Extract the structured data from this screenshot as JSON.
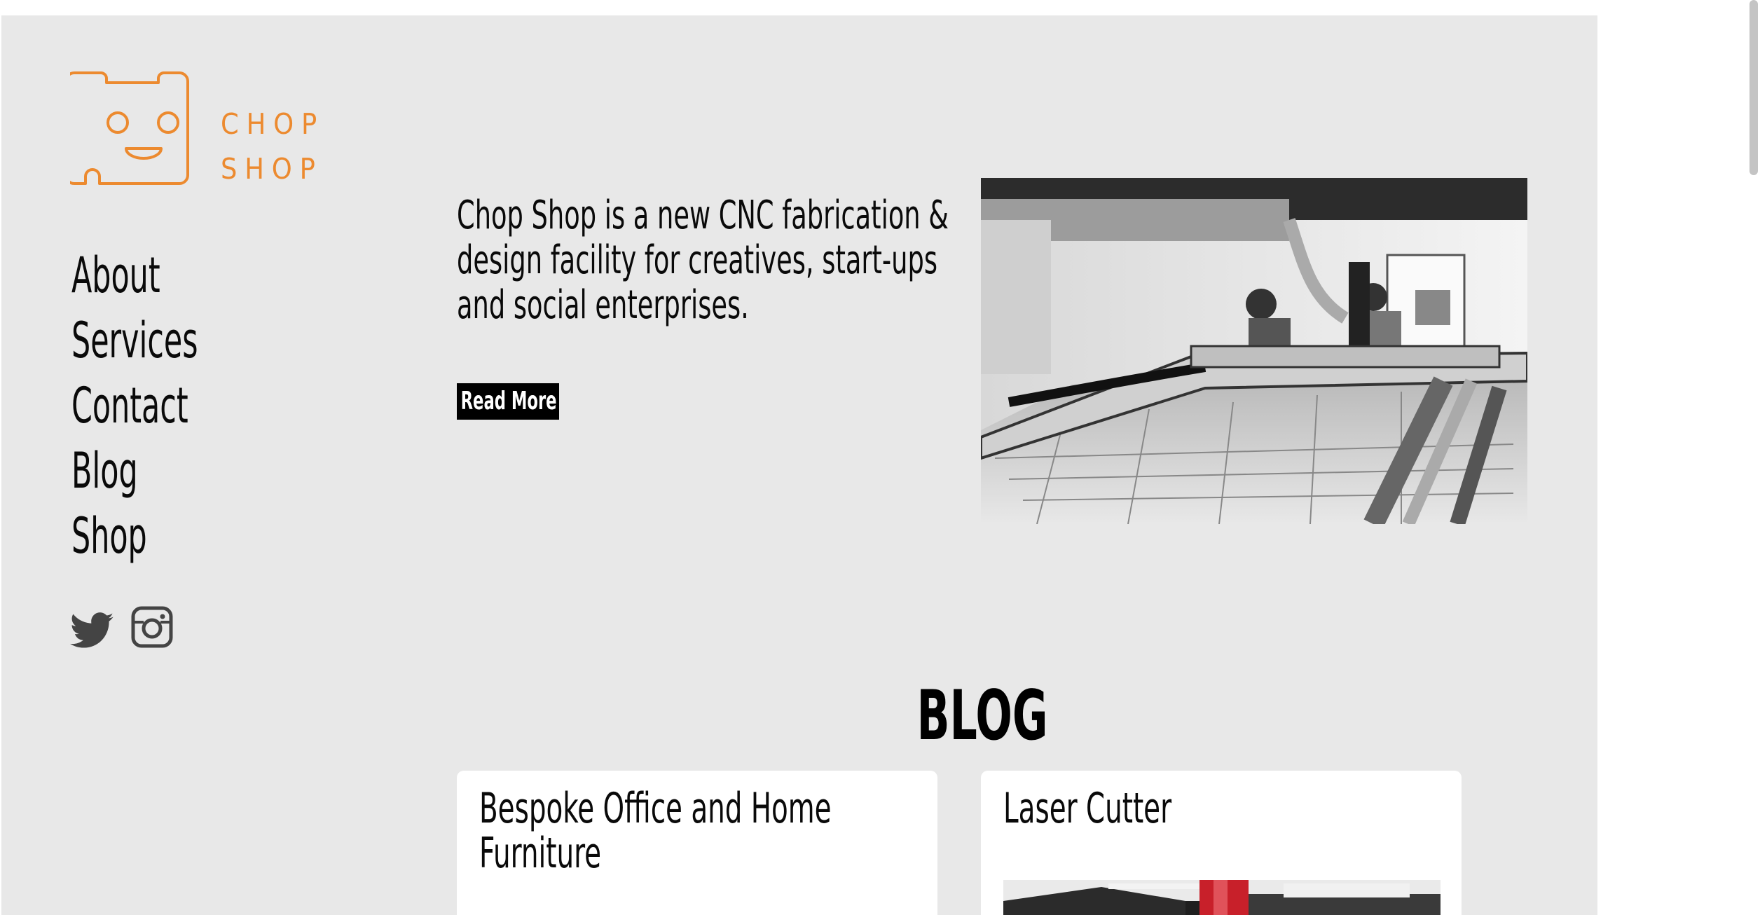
{
  "brand": {
    "line1": "CHOP",
    "line2": "SHOP",
    "accent_color": "#ec8a2f"
  },
  "nav": {
    "items": [
      {
        "label": "About"
      },
      {
        "label": "Services"
      },
      {
        "label": "Contact"
      },
      {
        "label": "Blog"
      },
      {
        "label": "Shop"
      }
    ]
  },
  "social": {
    "icons": [
      "twitter-icon",
      "instagram-icon"
    ]
  },
  "intro": {
    "text": "Chop Shop is a new CNC fabrication & design facility for creatives, start-ups and social enterprises.",
    "read_more_label": "Read More"
  },
  "hero": {
    "image_description_icon": "workshop-photo"
  },
  "blog": {
    "heading": "BLOG",
    "cards": [
      {
        "title": "Bespoke Office and Home Furniture"
      },
      {
        "title": "Laser Cutter"
      }
    ]
  }
}
